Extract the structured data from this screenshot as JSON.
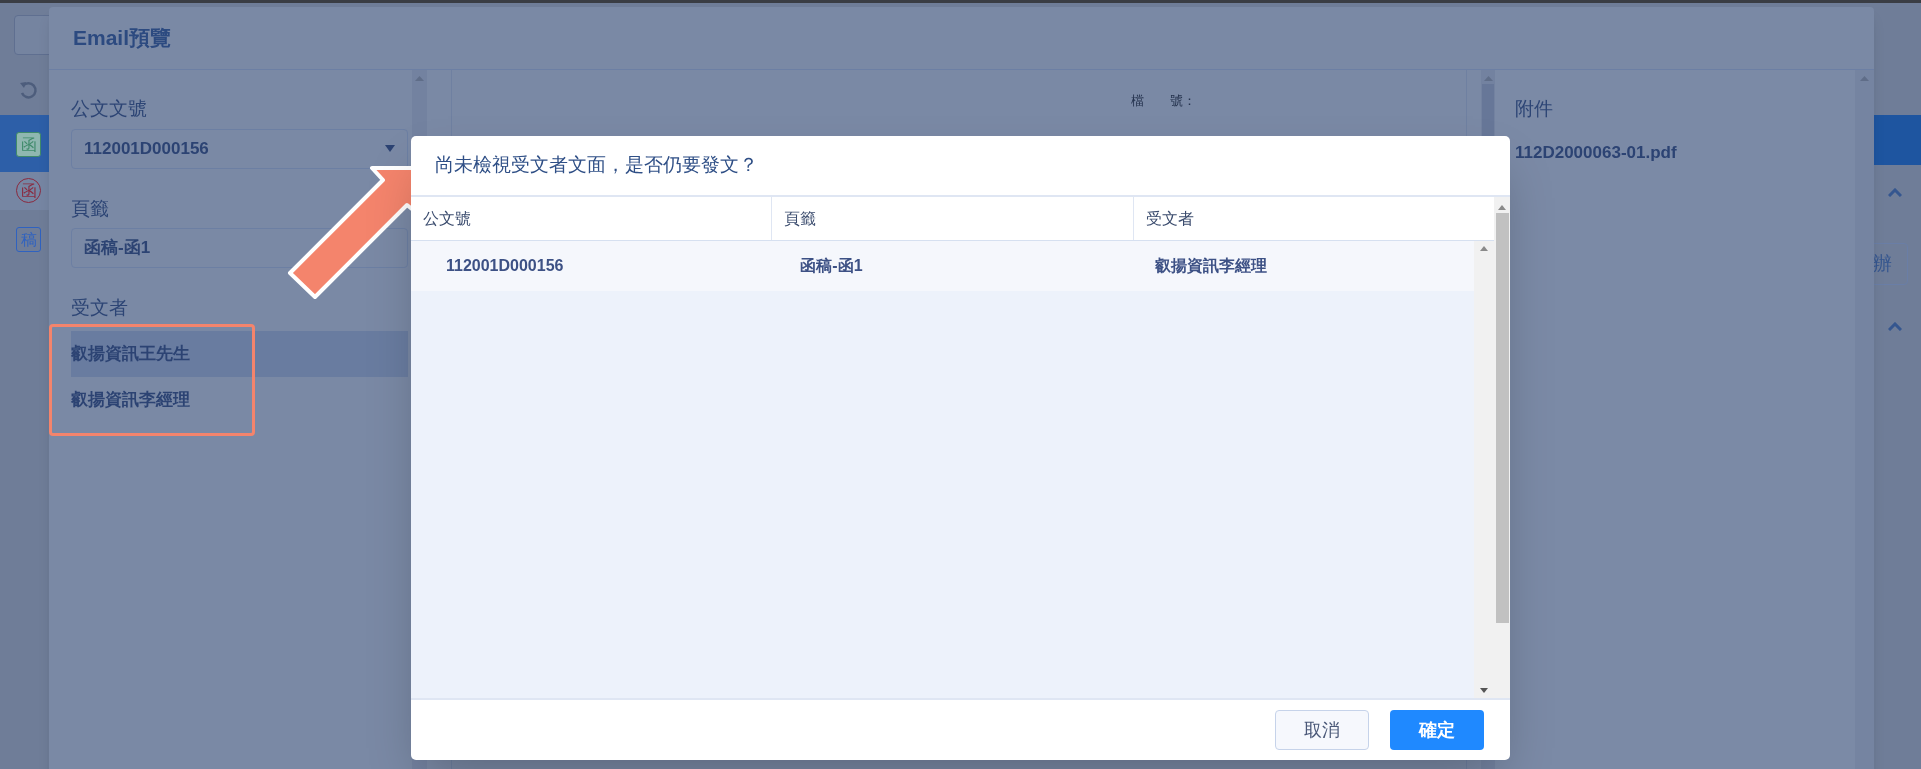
{
  "background": {
    "left_badges": [
      {
        "label": "函",
        "kind": "green"
      },
      {
        "label": "函",
        "kind": "red"
      },
      {
        "label": "稿",
        "kind": "blue"
      }
    ],
    "right_button": "辦"
  },
  "email_preview": {
    "title": "Email預覽",
    "fields": [
      {
        "label": "公文文號",
        "value": "112001D000156",
        "kind": "select"
      },
      {
        "label": "頁籤",
        "value": "函稿-函1",
        "kind": "text"
      }
    ],
    "recipients_label": "受文者",
    "recipients": [
      {
        "name": "叡揚資訊王先生",
        "selected": true
      },
      {
        "name": "叡揚資訊李經理",
        "selected": false
      }
    ],
    "document_lines": [
      "檔　　號："
    ],
    "attachments_label": "附件",
    "attachments": [
      "112D2000063-01.pdf"
    ]
  },
  "dialog": {
    "title": "尚未檢視受文者文面，是否仍要發文？",
    "columns": [
      "公文號",
      "頁籤",
      "受文者"
    ],
    "rows": [
      [
        "112001D000156",
        "函稿-函1",
        "叡揚資訊李經理"
      ]
    ],
    "buttons": [
      {
        "label": "取消",
        "kind": "secondary"
      },
      {
        "label": "確定",
        "kind": "primary"
      }
    ]
  }
}
